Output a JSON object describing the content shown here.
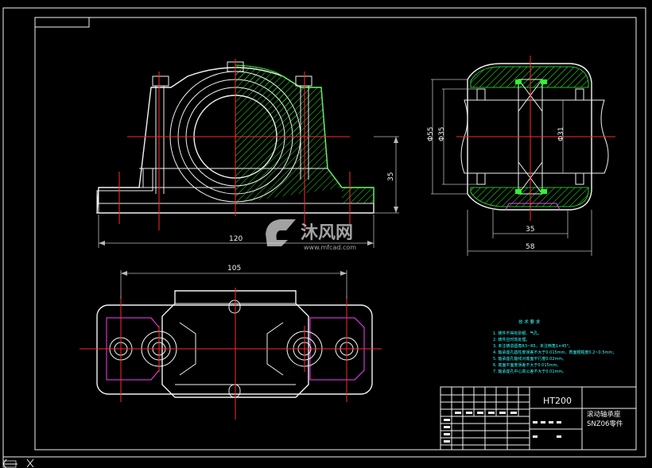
{
  "drawing": {
    "colors": {
      "background": "#000000",
      "outline": "#f2f2f2",
      "centerline": "#ff2a2a",
      "hatch": "#29ff29",
      "note_text": "#37ffff",
      "slot": "#ff3dff"
    },
    "dimensions": {
      "front_width": "120",
      "front_height": "35",
      "diam_outer": "Φ55",
      "diam_mid": "Φ35",
      "diam_shaft": "Φ31",
      "side_width_inner": "35",
      "side_width_outer": "58",
      "top_span": "105"
    },
    "notes": {
      "title": "技 术 要 求",
      "lines": [
        "1. 铸件不得有砂眼、气孔。",
        "2. 铸件应时效处理。",
        "3. 未注铸造圆角R3~R5，未注倒角1×45°。",
        "4. 轴承座孔圆柱度误差不大于0.015mm，表面粗糙度0.2~0.5mm；",
        "5. 轴承座孔轴线对底面平行度0.02mm。",
        "6. 底面平面度误差不大于0.015mm。",
        "7. 轴承座孔中心高公差不大于0.01mm。"
      ]
    },
    "title_block": {
      "material": "HT200",
      "name": "滚动轴承座",
      "part_no": "SNZ06零件"
    },
    "watermark": {
      "brand": "沐风网",
      "url": "www.mfcad.com"
    },
    "ucs_icon": "ucs-axis-icon"
  }
}
